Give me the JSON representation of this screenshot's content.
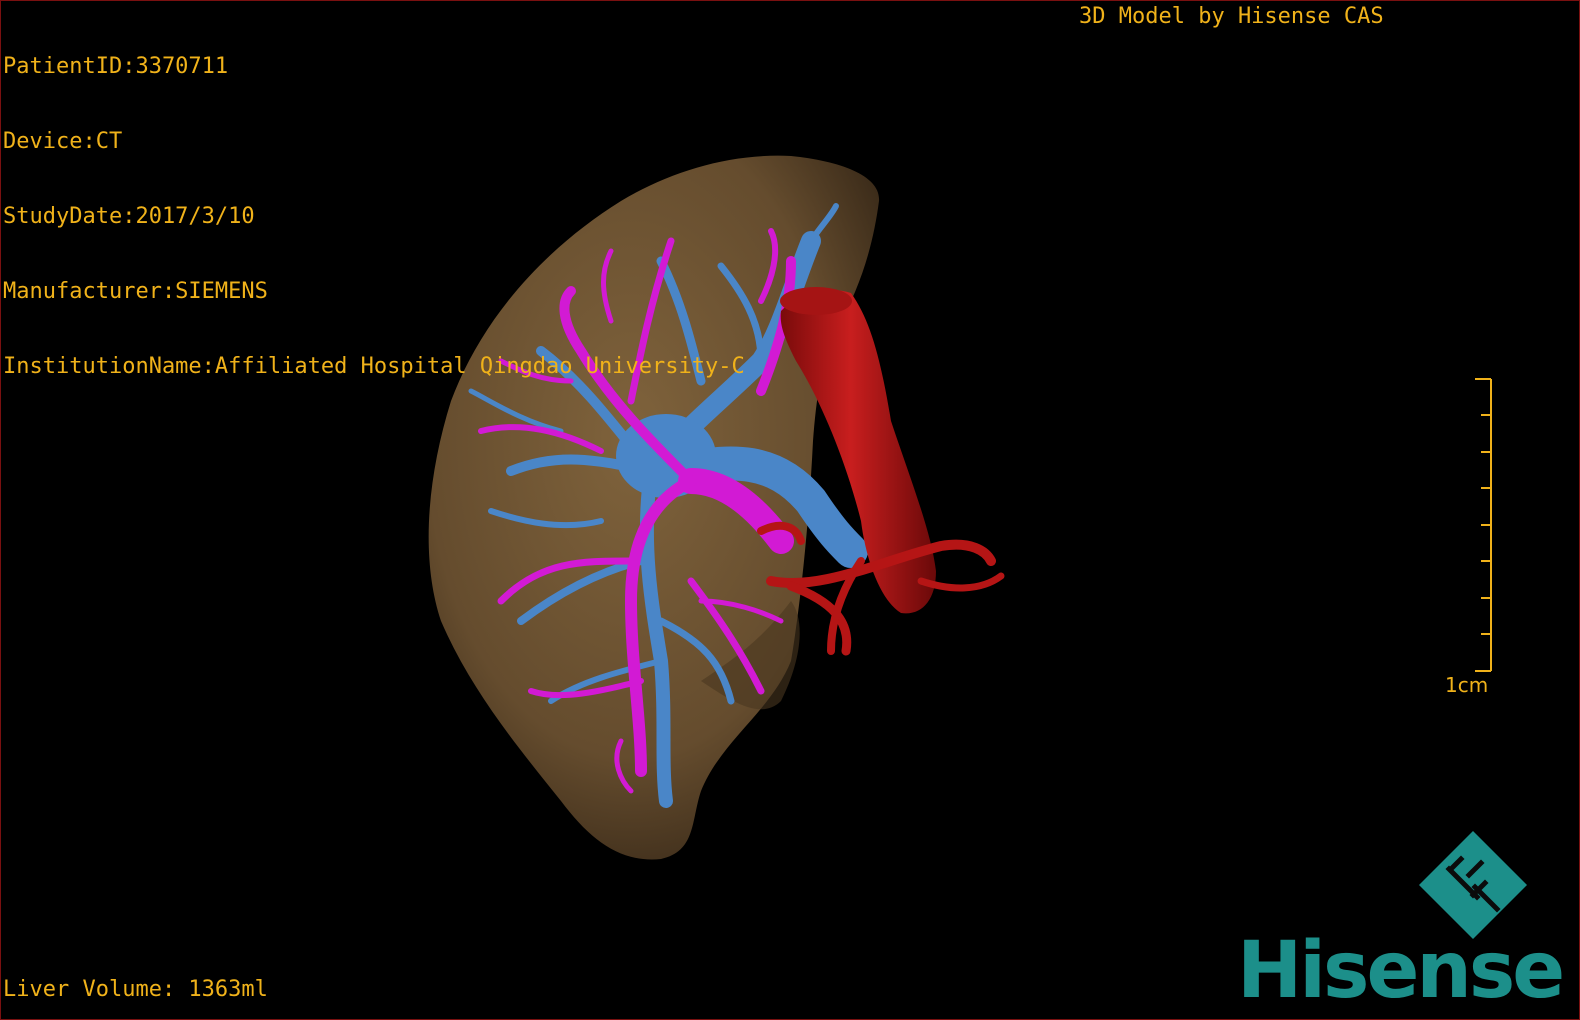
{
  "info": {
    "patient_id": "PatientID:3370711",
    "device": "Device:CT",
    "study_date": "StudyDate:2017/3/10",
    "manufacturer": "Manufacturer:SIEMENS",
    "institution": "InstitutionName:Affiliated Hospital Qingdao University-C"
  },
  "header": {
    "model_credit": "3D Model by Hisense CAS"
  },
  "footer": {
    "volume_readout": "Liver Volume: 1363ml"
  },
  "scale": {
    "label": "1cm"
  },
  "brand": {
    "name": "Hisense"
  },
  "colors": {
    "overlay_text": "#f0b21a",
    "liver": "#6e5434",
    "portal_vein": "#d21ad4",
    "hepatic_vein": "#4a86c8",
    "ivc": "#b51515",
    "brand": "#1c8f8a"
  }
}
